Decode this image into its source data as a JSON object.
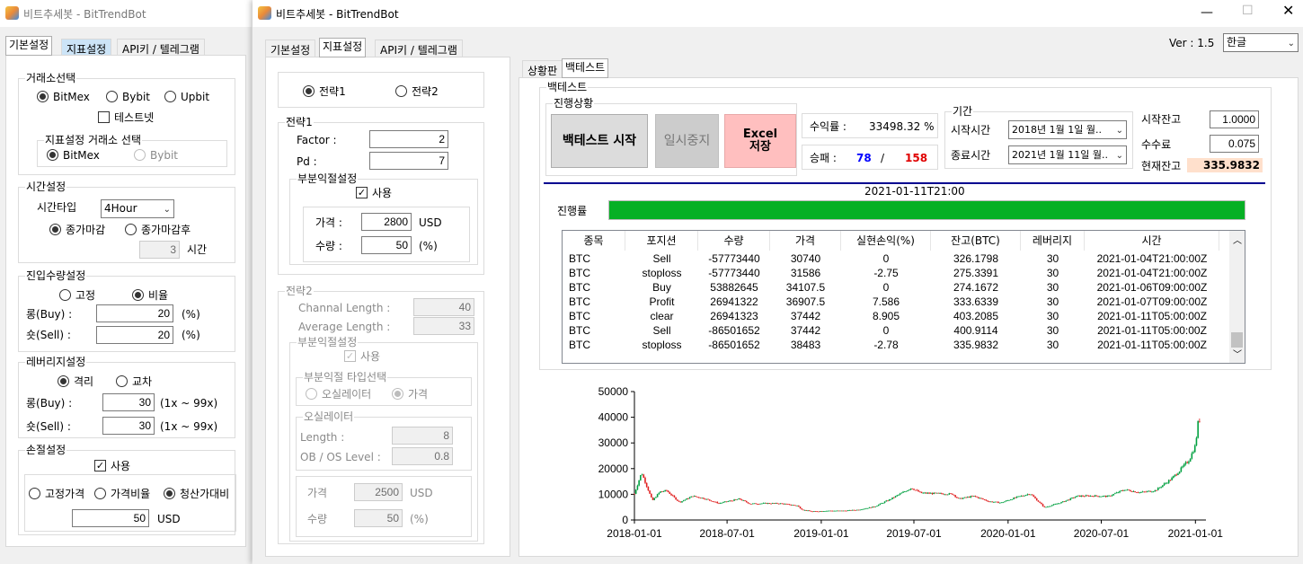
{
  "back_window": {
    "title": "비트추세봇 - BitTrendBot",
    "tabs": [
      "기본설정",
      "지표설정",
      "API키 / 텔레그램"
    ],
    "exchange": {
      "title": "거래소선택",
      "options": [
        "BitMex",
        "Bybit",
        "Upbit"
      ],
      "selected": "BitMex",
      "testnet_label": "테스트넷",
      "testnet_checked": false,
      "indicator_exchange_title": "지표설정 거래소 선택",
      "indicator_options": [
        "BitMex",
        "Bybit"
      ],
      "indicator_selected": "BitMex"
    },
    "time": {
      "title": "시간설정",
      "type_label": "시간타입",
      "type_value": "4Hour",
      "options": [
        "종가마감",
        "종가마감후"
      ],
      "selected": "종가마감",
      "hours_value": "3",
      "hours_unit": "시간"
    },
    "entry": {
      "title": "진입수량설정",
      "options": [
        "고정",
        "비율"
      ],
      "selected": "비율",
      "long_label": "롱(Buy) :",
      "long_value": "20",
      "short_label": "숏(Sell) :",
      "short_value": "20",
      "unit": "(%)"
    },
    "leverage": {
      "title": "레버리지설정",
      "options": [
        "격리",
        "교차"
      ],
      "selected": "격리",
      "long_label": "롱(Buy) :",
      "long_value": "30",
      "short_label": "숏(Sell) :",
      "short_value": "30",
      "range": "(1x ~ 99x)"
    },
    "stoploss": {
      "title": "손절설정",
      "use_label": "사용",
      "use_checked": true,
      "options": [
        "고정가격",
        "가격비율",
        "청산가대비"
      ],
      "selected": "청산가대비",
      "value": "50",
      "unit": "USD"
    }
  },
  "front_window": {
    "title": "비트추세봇 - BitTrendBot",
    "tabs": [
      "기본설정",
      "지표설정",
      "API키 / 텔레그램"
    ],
    "strategy_options": [
      "전략1",
      "전략2"
    ],
    "strategy_selected": "전략1",
    "strategy1": {
      "title": "전략1",
      "factor_label": "Factor :",
      "factor_value": "2",
      "pd_label": "Pd :",
      "pd_value": "7",
      "partial": {
        "title": "부분익절설정",
        "use_label": "사용",
        "use_checked": true,
        "price_label": "가격 :",
        "price_value": "2800",
        "price_unit": "USD",
        "qty_label": "수량 :",
        "qty_value": "50",
        "qty_unit": "(%)"
      }
    },
    "strategy2": {
      "title": "전략2",
      "channel_label": "Channal Length :",
      "channel_value": "40",
      "average_label": "Average Length :",
      "average_value": "33",
      "partial_title": "부분익절설정",
      "use_label": "사용",
      "type_title": "부분익절 타입선택",
      "type_options": [
        "오실레이터",
        "가격"
      ],
      "type_selected": "가격",
      "osc_title": "오실레이터",
      "length_label": "Length :",
      "length_value": "8",
      "obos_label": "OB / OS Level :",
      "obos_value": "0.8",
      "price_label": "가격",
      "price_value": "2500",
      "price_unit": "USD",
      "qty_label": "수량",
      "qty_value": "50",
      "qty_unit": "(%)"
    },
    "version": "Ver : 1.5",
    "language": "한글",
    "right_tabs": [
      "상황판",
      "백테스트"
    ],
    "backtest": {
      "title": "백테스트",
      "progress_group_title": "진행상황",
      "start_button": "백테스트 시작",
      "pause_button": "일시중지",
      "excel_button": "Excel\n저장",
      "return_label": "수익률 :",
      "return_value": "33498.32 %",
      "winloss_label": "승패 :",
      "wins": "78",
      "separator": "/",
      "losses": "158",
      "period_title": "기간",
      "start_time_label": "시작시간",
      "start_date": "2018년   1월   1일 월..",
      "end_time_label": "종료시간",
      "end_date": "2021년   1월 11일 월..",
      "start_balance_label": "시작잔고",
      "start_balance_value": "1.0000",
      "fee_label": "수수료",
      "fee_value": "0.075",
      "current_balance_label": "현재잔고",
      "current_balance_value": "335.9832",
      "current_timestamp": "2021-01-11T21:00",
      "progress_label": "진행률",
      "progress_fraction": 1.0,
      "table": {
        "columns": [
          "종목",
          "포지션",
          "수량",
          "가격",
          "실현손익(%)",
          "잔고(BTC)",
          "레버리지",
          "시간"
        ],
        "rows": [
          [
            "BTC",
            "Sell",
            "-57773440",
            "30740",
            "0",
            "326.1798",
            "30",
            "2021-01-04T21:00:00Z"
          ],
          [
            "BTC",
            "stoploss",
            "-57773440",
            "31586",
            "-2.75",
            "275.3391",
            "30",
            "2021-01-04T21:00:00Z"
          ],
          [
            "BTC",
            "Buy",
            "53882645",
            "34107.5",
            "0",
            "274.1672",
            "30",
            "2021-01-06T09:00:00Z"
          ],
          [
            "BTC",
            "Profit",
            "26941322",
            "36907.5",
            "7.586",
            "333.6339",
            "30",
            "2021-01-07T09:00:00Z"
          ],
          [
            "BTC",
            "clear",
            "26941323",
            "37442",
            "8.905",
            "403.2085",
            "30",
            "2021-01-11T05:00:00Z"
          ],
          [
            "BTC",
            "Sell",
            "-86501652",
            "37442",
            "0",
            "400.9114",
            "30",
            "2021-01-11T05:00:00Z"
          ],
          [
            "BTC",
            "stoploss",
            "-86501652",
            "38483",
            "-2.78",
            "335.9832",
            "30",
            "2021-01-11T05:00:00Z"
          ]
        ]
      }
    }
  },
  "colors": {
    "progress_green": "#06b025",
    "wins_blue": "#0000ff",
    "losses_red": "#e00000",
    "excel_button_bg": "#ffbfbf",
    "balance_highlight": "#ffe0cc",
    "bull_candle": "#00a040",
    "bear_candle": "#e02020"
  },
  "chart_data": {
    "type": "candlestick",
    "title": "",
    "x_tick_labels": [
      "2018-01-01",
      "2018-07-01",
      "2019-01-01",
      "2019-07-01",
      "2020-01-01",
      "2020-07-01",
      "2021-01-01"
    ],
    "y_tick_labels": [
      "0",
      "10000",
      "20000",
      "30000",
      "40000",
      "50000"
    ],
    "ylim": [
      0,
      50000
    ],
    "x_range": [
      "2018-01-01",
      "2021-01-11"
    ],
    "grid": false,
    "series": [
      {
        "values_by_month_close": [
          [
            "2018-01-01",
            10200
          ],
          [
            "2018-01-15",
            18500
          ],
          [
            "2018-02-05",
            7500
          ],
          [
            "2018-02-20",
            11000
          ],
          [
            "2018-03-05",
            11400
          ],
          [
            "2018-03-30",
            6900
          ],
          [
            "2018-04-25",
            9300
          ],
          [
            "2018-05-15",
            8500
          ],
          [
            "2018-06-15",
            6500
          ],
          [
            "2018-07-25",
            8200
          ],
          [
            "2018-08-15",
            6300
          ],
          [
            "2018-09-15",
            6500
          ],
          [
            "2018-10-15",
            6400
          ],
          [
            "2018-11-15",
            5600
          ],
          [
            "2018-11-25",
            4000
          ],
          [
            "2018-12-15",
            3300
          ],
          [
            "2019-01-15",
            3600
          ],
          [
            "2019-02-15",
            3600
          ],
          [
            "2019-03-15",
            4000
          ],
          [
            "2019-04-15",
            5200
          ],
          [
            "2019-05-15",
            8000
          ],
          [
            "2019-06-26",
            12500
          ],
          [
            "2019-07-15",
            10500
          ],
          [
            "2019-08-15",
            10300
          ],
          [
            "2019-09-15",
            10100
          ],
          [
            "2019-09-26",
            8200
          ],
          [
            "2019-10-26",
            9300
          ],
          [
            "2019-11-25",
            7200
          ],
          [
            "2019-12-18",
            6700
          ],
          [
            "2020-01-15",
            8700
          ],
          [
            "2020-02-13",
            10300
          ],
          [
            "2020-03-12",
            4900
          ],
          [
            "2020-04-15",
            6900
          ],
          [
            "2020-05-15",
            9300
          ],
          [
            "2020-06-15",
            9400
          ],
          [
            "2020-07-15",
            9200
          ],
          [
            "2020-08-15",
            11800
          ],
          [
            "2020-09-15",
            10700
          ],
          [
            "2020-10-15",
            11500
          ],
          [
            "2020-11-15",
            16000
          ],
          [
            "2020-12-01",
            19200
          ],
          [
            "2020-12-20",
            23500
          ],
          [
            "2021-01-01",
            29000
          ],
          [
            "2021-01-08",
            41000
          ],
          [
            "2021-01-11",
            35500
          ]
        ]
      }
    ]
  }
}
